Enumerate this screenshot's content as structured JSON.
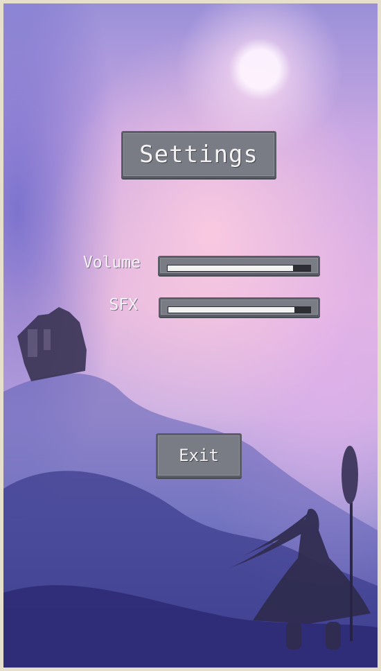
{
  "screen": {
    "title": "Settings"
  },
  "settings": {
    "volume": {
      "label": "Volume",
      "level": 0.88
    },
    "sfx": {
      "label": "SFX",
      "level": 0.89
    }
  },
  "actions": {
    "exit_label": "Exit"
  },
  "colors": {
    "panel": "#7a7c85",
    "panel_border": "#5a5c66",
    "track": "#2d2e34",
    "fill": "#f3f3f3",
    "text": "#f4f2f2",
    "frame": "#e6dfcc"
  }
}
